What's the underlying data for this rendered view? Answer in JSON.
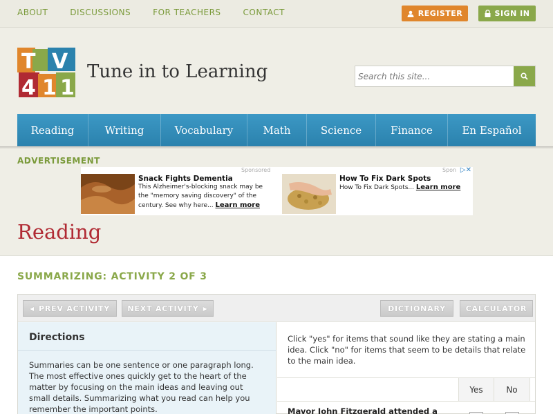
{
  "topnav": {
    "items": [
      "ABOUT",
      "DISCUSSIONS",
      "FOR TEACHERS",
      "CONTACT"
    ],
    "register_label": "REGISTER",
    "signin_label": "SIGN IN"
  },
  "header": {
    "logo_text": "TV411",
    "site_title": "Tune in to Learning",
    "search_placeholder": "Search this site..."
  },
  "mainnav": {
    "items": [
      "Reading",
      "Writing",
      "Vocabulary",
      "Math",
      "Science",
      "Finance",
      "En Español"
    ]
  },
  "ad": {
    "label": "ADVERTISEMENT",
    "sponsored": "Sponsored",
    "sponsored_short": "Spon",
    "items": [
      {
        "title": "Snack Fights Dementia",
        "desc": "This Alzheimer's-blocking snack may be the \"memory saving discovery\" of the century. See why here...",
        "cta": "Learn more"
      },
      {
        "title": "How To Fix Dark Spots",
        "desc": "How To Fix Dark Spots...",
        "cta": "Learn more"
      }
    ]
  },
  "page": {
    "title": "Reading",
    "activity_title": "SUMMARIZING: ACTIVITY 2 OF 3"
  },
  "toolbar": {
    "prev_label": "PREV ACTIVITY",
    "next_label": "NEXT ACTIVITY",
    "dictionary_label": "DICTIONARY",
    "calculator_label": "CALCULATOR"
  },
  "directions": {
    "title": "Directions",
    "body": "Summaries can be one sentence or one paragraph long. The most effective ones quickly get to the heart of the matter by focusing on the main ideas and leaving out small details. Summarizing what you read can help you remember the important points."
  },
  "question": {
    "intro": "Click \"yes\" for items that sound like they are stating a main idea. Click \"no\" for items that seem to be details that relate to the main idea.",
    "col_yes": "Yes",
    "col_no": "No",
    "first_item": "Mayor John Fitzgerald attended a"
  },
  "colors": {
    "green": "#8aa84a",
    "orange": "#e0862c",
    "blue": "#2b82ad",
    "red": "#b02a33"
  }
}
